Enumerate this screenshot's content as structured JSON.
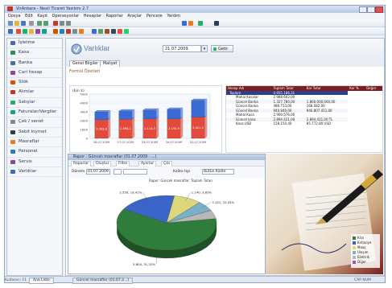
{
  "window": {
    "title": "VirAnkara - Nexil Ticaret Yazılımı 2.7"
  },
  "menu": [
    "Dosya",
    "Edit",
    "Kayıt",
    "Operasyonlar",
    "Hesaplar",
    "Raporlar",
    "Araçlar",
    "Pencere",
    "Yardım"
  ],
  "sidebar": {
    "items": [
      {
        "label": "İşletme",
        "color": "#3b6fb5"
      },
      {
        "label": "Kasa",
        "color": "#2e8b57"
      },
      {
        "label": "Banka",
        "color": "#4a6fa5"
      },
      {
        "label": "Cari hesap",
        "color": "#8e44ad"
      },
      {
        "label": "Stok",
        "color": "#d35400"
      },
      {
        "label": "Alımlar",
        "color": "#c0392b"
      },
      {
        "label": "Satışlar",
        "color": "#27ae60"
      },
      {
        "label": "Faturalar/Vergiler",
        "color": "#16a085"
      },
      {
        "label": "Çek / senet",
        "color": "#7f8c8d"
      },
      {
        "label": "Sabit kıymet",
        "color": "#2c3e50"
      },
      {
        "label": "Masraflar",
        "color": "#e67e22"
      },
      {
        "label": "Personel",
        "color": "#2980b9"
      },
      {
        "label": "Servis",
        "color": "#8e44ad"
      },
      {
        "label": "Varlıklar",
        "color": "#3b6fb5"
      }
    ]
  },
  "header": {
    "title": "Varlıklar",
    "date": "21.07.2009",
    "go_label": "Getir"
  },
  "tabs": [
    "Genel Bilgiler",
    "Maliyet"
  ],
  "panel_title": "Formül Özetleri",
  "bar_chart": {
    "unit": "(bin $)",
    "chart_data": {
      "type": "bar",
      "categories": [
        "30.07.2009",
        "17.07.2009",
        "23.07.2009",
        "24.07.2009",
        "31.07.2009"
      ],
      "series": [
        {
          "values": [
            2100,
            2150,
            2200,
            2200,
            2400
          ],
          "color": "#e24a3b"
        },
        {
          "values": [
            900,
            950,
            1000,
            1100,
            1900
          ],
          "color": "#3a6ad4"
        }
      ],
      "yticks": [
        "5000",
        "4000",
        "3000",
        "2000",
        "1000",
        "0"
      ],
      "data_labels": [
        "2.093,8",
        "2.094,1",
        "2.114,5",
        "2.193,9",
        "2.421,2"
      ],
      "ylim": [
        0,
        5000
      ]
    }
  },
  "right_table": {
    "headers": [
      "Hesap Adı",
      "Toplam Tutar",
      "Kar Tutar",
      "Kar %",
      "Değer"
    ],
    "rows": [
      {
        "name": "Toplam",
        "a": "4.955.186,31",
        "b": "",
        "sel": true
      },
      {
        "name": "Mahal Kasalar",
        "a": "2.988.602,00",
        "b": ""
      },
      {
        "name": "Güncel Banka",
        "a": "1.327.780,00",
        "b": "1.860.000.000,00"
      },
      {
        "name": "Güncel Banka",
        "a": "486.713,00",
        "b": "168.082.00"
      },
      {
        "name": "Güncel Banka",
        "a": "940.840,00",
        "b": "940.807.411,00"
      },
      {
        "name": "Mahal Kasa",
        "a": "2.900.576,00",
        "b": ""
      },
      {
        "name": "Güncel kasa",
        "a": "2.894.421,00",
        "b": "2.894.421,00 TL"
      },
      {
        "name": "Kasa USD",
        "a": "158.150,40",
        "b": "85.772,80 USD"
      }
    ]
  },
  "report": {
    "title": "Rapor : Güncelı masraflar (01.07.2009 - ...)",
    "toolbar": [
      "Raporlar",
      "Oluştur",
      "Filtre",
      "Ayarlar",
      "Çıkı"
    ],
    "filters": {
      "label1": "Dönem",
      "date": "01.07.2009",
      "label2": "Kalite tipi",
      "value2": "Bütün Kalite"
    },
    "chart_title": "Rapor: Günceli masraflar: Toplam Tutarı",
    "pie": {
      "chart_data": {
        "type": "pie",
        "slices": [
          {
            "label": "5.800, 31,32%",
            "value": 61.0,
            "color": "#2f7d3a"
          },
          {
            "label": "2.550, 19,41%",
            "value": 19.0,
            "color": "#3a64c8"
          },
          {
            "label": "1.140, 3,63%",
            "value": 9.0,
            "color": "#dcd77a"
          },
          {
            "label": "3.151, 22,03%",
            "value": 6.0,
            "color": "#7bb0c9"
          },
          {
            "label": "",
            "value": 5.0,
            "color": "#b8b8b8"
          }
        ]
      }
    },
    "legend": [
      "Kira",
      "Kırtasiye",
      "Maaş",
      "Ulaşım",
      "Elektrik",
      "Diğer"
    ]
  },
  "taskbar": {
    "items": [
      "Ana Liste",
      "Güncel masraflar (01.07.2...)"
    ]
  },
  "status": {
    "left": "Kullanıcı: F1",
    "right": "CAP  NUM"
  }
}
